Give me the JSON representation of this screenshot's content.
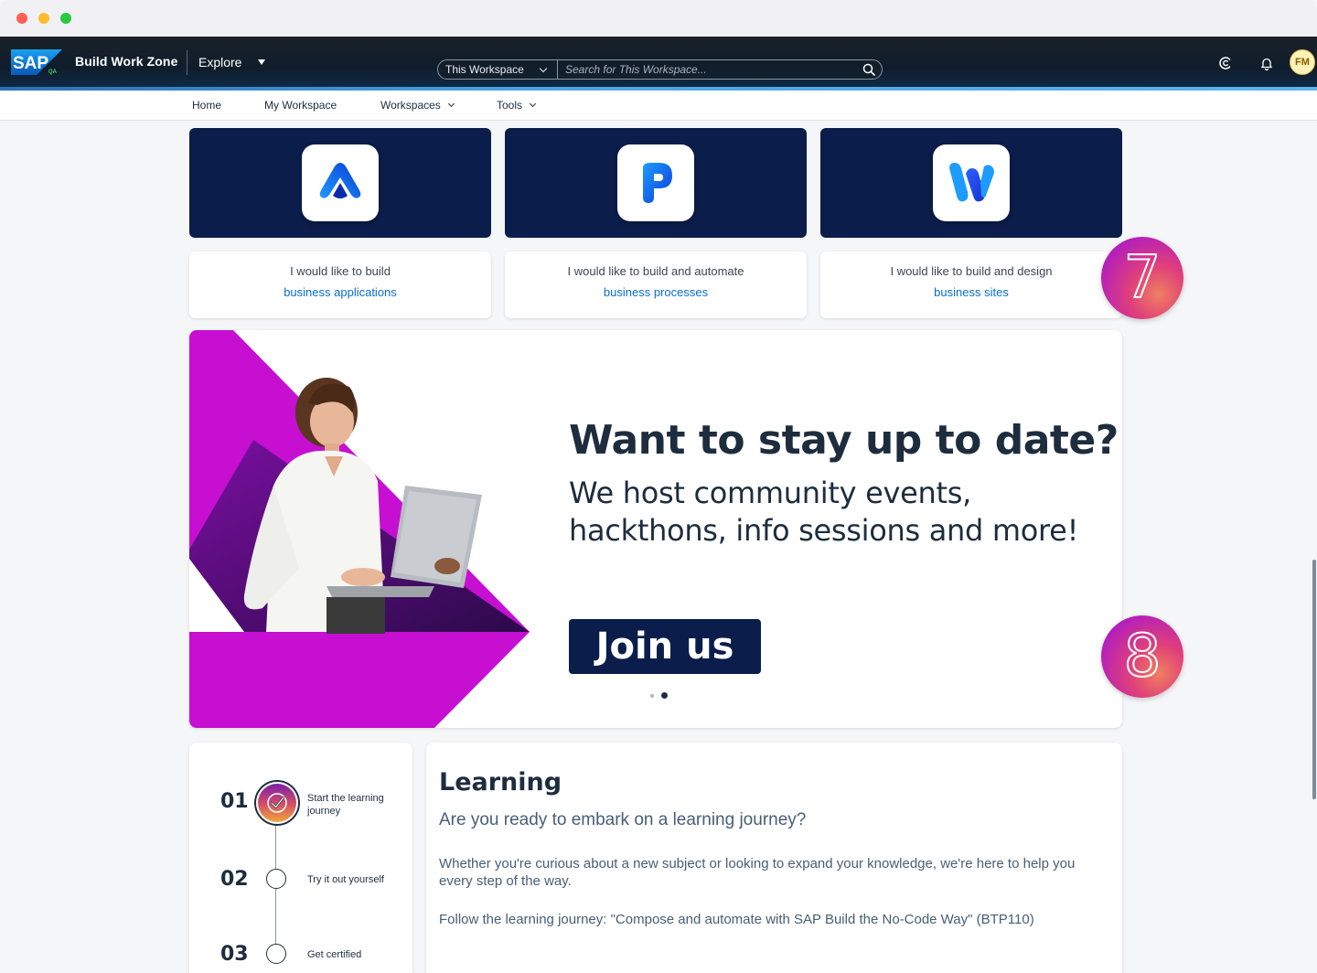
{
  "shell": {
    "logo_text": "SAP",
    "logo_badge": "QA",
    "product_name": "Build Work Zone",
    "explore_label": "Explore",
    "search_scope": "This Workspace",
    "search_placeholder": "Search for This Workspace...",
    "avatar_initials": "FM"
  },
  "nav": {
    "items": [
      {
        "label": "Home"
      },
      {
        "label": "My Workspace"
      },
      {
        "label": "Workspaces"
      },
      {
        "label": "Tools"
      }
    ]
  },
  "products": [
    {
      "icon": "sap-build-apps-icon",
      "line1": "I would like to build",
      "line2": "business applications"
    },
    {
      "icon": "sap-build-process-automation-icon",
      "line1": "I would like to build and automate",
      "line2": "business processes"
    },
    {
      "icon": "sap-build-work-zone-icon",
      "line1": "I would like to build and design",
      "line2": "business sites"
    }
  ],
  "badges": {
    "step7": "7",
    "step8": "8"
  },
  "banner": {
    "title": "Want to stay up to date?",
    "subtitle": "We host community events, hackthons, info sessions and more!",
    "cta": "Join us",
    "pages": 2,
    "active_page": 2
  },
  "journey": {
    "steps": [
      {
        "number": "01",
        "label": "Start the learning journey",
        "completed": true
      },
      {
        "number": "02",
        "label": "Try it out yourself",
        "completed": false
      },
      {
        "number": "03",
        "label": "Get certified",
        "completed": false
      }
    ]
  },
  "learning": {
    "title": "Learning",
    "lead": "Are you ready to embark on a learning journey?",
    "body": "Whether you're curious about a new subject or looking to expand your knowledge, we're here to help you every step of the way.",
    "follow": "Follow the learning journey: \"Compose and automate with SAP Build the No-Code Way\" (BTP110)"
  },
  "colors": {
    "shell_bg": "#0f1d2c",
    "accent_blue": "#0a6ed1",
    "tile_navy": "#0b1d4a",
    "banner_magenta": "#c60fd1",
    "badge_gradient_start": "#b01cc0",
    "badge_gradient_end": "#f07f5f"
  }
}
